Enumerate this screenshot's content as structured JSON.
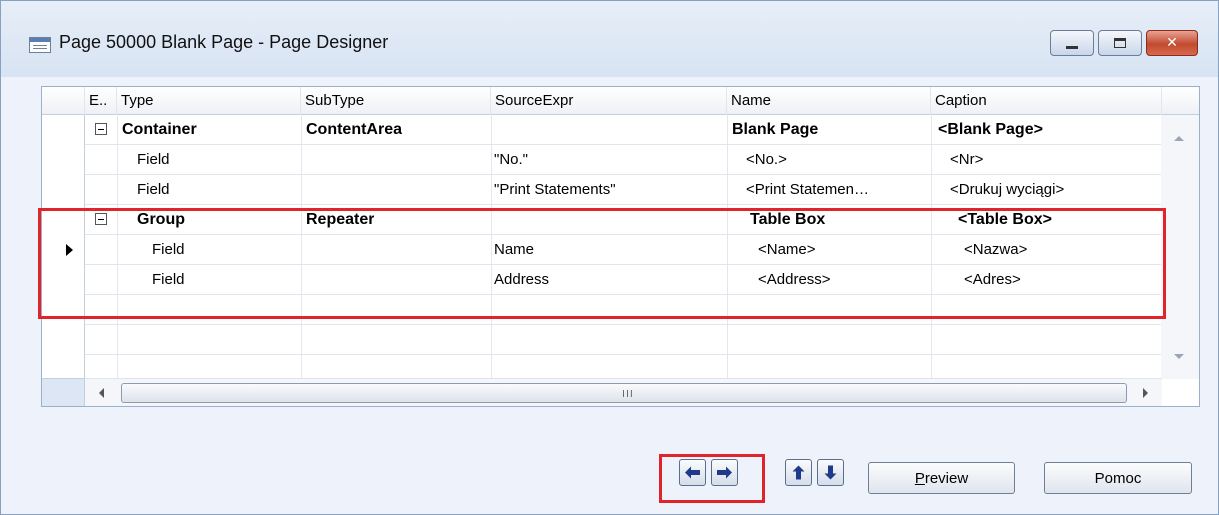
{
  "window": {
    "title": "Page 50000 Blank Page - Page Designer",
    "min_icon": "minimize-icon",
    "max_icon": "maximize-icon",
    "close_label": "✕"
  },
  "grid": {
    "columns": [
      "E..",
      "Type",
      "SubType",
      "SourceExpr",
      "Name",
      "Caption"
    ],
    "rows": [
      {
        "expander": true,
        "type": "Container",
        "subtype": "ContentArea",
        "source": "",
        "name": "Blank Page",
        "caption": "<Blank Page>",
        "bold": true,
        "level": 0
      },
      {
        "expander": false,
        "type": "Field",
        "subtype": "",
        "source": "\"No.\"",
        "name": "<No.>",
        "caption": "<Nr>",
        "bold": false,
        "level": 1
      },
      {
        "expander": false,
        "type": "Field",
        "subtype": "",
        "source": "\"Print Statements\"",
        "name": "<Print Statemen…",
        "caption": "<Drukuj wyciągi>",
        "bold": false,
        "level": 1
      },
      {
        "expander": true,
        "type": "Group",
        "subtype": "Repeater",
        "source": "",
        "name": "Table Box",
        "caption": "<Table Box>",
        "bold": true,
        "level": 1
      },
      {
        "expander": false,
        "type": "Field",
        "subtype": "",
        "source": "Name",
        "name": "<Name>",
        "caption": "<Nazwa>",
        "bold": false,
        "level": 2,
        "current": true
      },
      {
        "expander": false,
        "type": "Field",
        "subtype": "",
        "source": "Address",
        "name": "<Address>",
        "caption": "<Adres>",
        "bold": false,
        "level": 2
      }
    ],
    "scroll_grip": "III"
  },
  "buttons": {
    "left_label": "left-arrow",
    "right_label": "right-arrow",
    "up_label": "up-arrow",
    "down_label": "down-arrow",
    "preview_first": "P",
    "preview_rest": "review",
    "help": "Pomoc"
  },
  "colors": {
    "highlight": "#e1232a",
    "arrow": "#1f3a8a"
  }
}
